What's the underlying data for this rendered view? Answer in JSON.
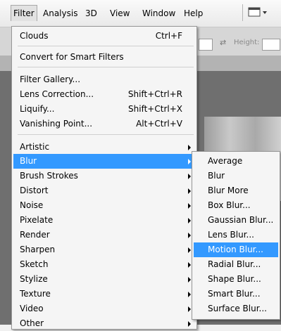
{
  "menubar": {
    "items": [
      "Filter",
      "Analysis",
      "3D",
      "View",
      "Window",
      "Help"
    ],
    "active": "Filter",
    "workspace_icon": "workspace-screen-icon"
  },
  "toolbar": {
    "height_label": "Height:"
  },
  "filter_menu": {
    "items": [
      {
        "label": "Clouds",
        "shortcut": "Ctrl+F"
      },
      {
        "label": "Convert for Smart Filters",
        "shortcut": ""
      },
      {
        "label": "Filter Gallery...",
        "shortcut": ""
      },
      {
        "label": "Lens Correction...",
        "shortcut": "Shift+Ctrl+R"
      },
      {
        "label": "Liquify...",
        "shortcut": "Shift+Ctrl+X"
      },
      {
        "label": "Vanishing Point...",
        "shortcut": "Alt+Ctrl+V"
      },
      {
        "label": "Artistic",
        "submenu": true
      },
      {
        "label": "Blur",
        "submenu": true,
        "highlighted": true
      },
      {
        "label": "Brush Strokes",
        "submenu": true
      },
      {
        "label": "Distort",
        "submenu": true
      },
      {
        "label": "Noise",
        "submenu": true
      },
      {
        "label": "Pixelate",
        "submenu": true
      },
      {
        "label": "Render",
        "submenu": true
      },
      {
        "label": "Sharpen",
        "submenu": true
      },
      {
        "label": "Sketch",
        "submenu": true
      },
      {
        "label": "Stylize",
        "submenu": true
      },
      {
        "label": "Texture",
        "submenu": true
      },
      {
        "label": "Video",
        "submenu": true
      },
      {
        "label": "Other",
        "submenu": true
      }
    ]
  },
  "blur_submenu": {
    "items": [
      "Average",
      "Blur",
      "Blur More",
      "Box Blur...",
      "Gaussian Blur...",
      "Lens Blur...",
      "Motion Blur...",
      "Radial Blur...",
      "Shape Blur...",
      "Smart Blur...",
      "Surface Blur..."
    ],
    "highlighted": "Motion Blur..."
  },
  "colors": {
    "highlight": "#3399ff",
    "menu_bg": "#f5f5f5"
  }
}
